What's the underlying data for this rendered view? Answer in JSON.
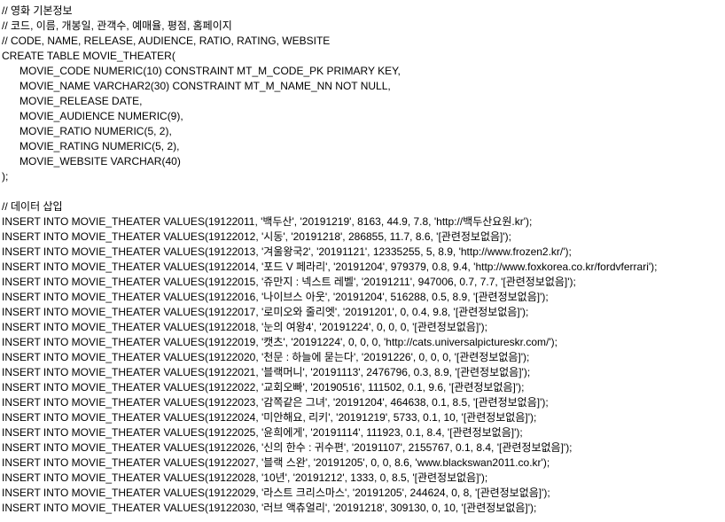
{
  "editor": {
    "comments": [
      "// 영화 기본정보",
      "// 코드, 이름, 개봉일, 관객수, 예매율, 평점, 홈페이지",
      "// CODE, NAME, RELEASE, AUDIENCE, RATIO, RATING, WEBSITE"
    ],
    "create_table": {
      "header": "CREATE TABLE MOVIE_THEATER(",
      "columns": [
        "MOVIE_CODE NUMERIC(10) CONSTRAINT MT_M_CODE_PK PRIMARY KEY,",
        "MOVIE_NAME VARCHAR2(30) CONSTRAINT MT_M_NAME_NN NOT NULL,",
        "MOVIE_RELEASE DATE,",
        "MOVIE_AUDIENCE NUMERIC(9),",
        "MOVIE_RATIO NUMERIC(5, 2),",
        "MOVIE_RATING NUMERIC(5, 2),",
        "MOVIE_WEBSITE VARCHAR(40)"
      ],
      "footer": ");"
    },
    "data_comment": "// 데이터 삽입",
    "inserts": [
      "INSERT INTO MOVIE_THEATER VALUES(19122011, '백두산', '20191219', 8163, 44.9, 7.8, 'http://백두산요원.kr');",
      "INSERT INTO MOVIE_THEATER VALUES(19122012, '시동', '20191218', 286855, 11.7, 8.6, '[관련정보없음]');",
      "INSERT INTO MOVIE_THEATER VALUES(19122013, '겨울왕국2', '20191121', 12335255, 5, 8.9, 'http://www.frozen2.kr/');",
      "INSERT INTO MOVIE_THEATER VALUES(19122014, '포드 V 페라리', '20191204', 979379, 0.8, 9.4, 'http://www.foxkorea.co.kr/fordvferrari');",
      "INSERT INTO MOVIE_THEATER VALUES(19122015, '쥬만지 : 넥스트 레벨', '20191211', 947006, 0.7, 7.7, '[관련정보없음]');",
      "INSERT INTO MOVIE_THEATER VALUES(19122016, '나이브스 아웃', '20191204', 516288, 0.5, 8.9, '[관련정보없음]');",
      "INSERT INTO MOVIE_THEATER VALUES(19122017, '로미오와 줄리엣', '20191201', 0, 0.4, 9.8, '[관련정보없음]');",
      "INSERT INTO MOVIE_THEATER VALUES(19122018, '눈의 여왕4', '20191224', 0, 0, 0, '[관련정보없음]');",
      "INSERT INTO MOVIE_THEATER VALUES(19122019, '캣츠', '20191224', 0, 0, 0, 'http://cats.universalpictureskr.com/');",
      "INSERT INTO MOVIE_THEATER VALUES(19122020, '천문 : 하늘에 묻는다', '20191226', 0, 0, 0, '[관련정보없음]');",
      "INSERT INTO MOVIE_THEATER VALUES(19122021, '블랙머니', '20191113', 2476796, 0.3, 8.9, '[관련정보없음]');",
      "INSERT INTO MOVIE_THEATER VALUES(19122022, '교회오빠', '20190516', 111502, 0.1, 9.6, '[관련정보없음]');",
      "INSERT INTO MOVIE_THEATER VALUES(19122023, '감쪽같은 그녀', '20191204', 464638, 0.1, 8.5, '[관련정보없음]');",
      "INSERT INTO MOVIE_THEATER VALUES(19122024, '미안해요, 리키', '20191219', 5733, 0.1, 10, '[관련정보없음]');",
      "INSERT INTO MOVIE_THEATER VALUES(19122025, '윤희에게', '20191114', 111923, 0.1, 8.4, '[관련정보없음]');",
      "INSERT INTO MOVIE_THEATER VALUES(19122026, '신의 한수 : 귀수편', '20191107', 2155767, 0.1, 8.4, '[관련정보없음]');",
      "INSERT INTO MOVIE_THEATER VALUES(19122027, '블랙 스완', '20191205', 0, 0, 8.6, 'www.blackswan2011.co.kr');",
      "INSERT INTO MOVIE_THEATER VALUES(19122028, '10년', '20191212', 1333, 0, 8.5, '[관련정보없음]');",
      "INSERT INTO MOVIE_THEATER VALUES(19122029, '라스트 크리스마스', '20191205', 244624, 0, 8, '[관련정보없음]');",
      "INSERT INTO MOVIE_THEATER VALUES(19122030, '러브 액츄얼리', '20191218', 309130, 0, 10, '[관련정보없음]');"
    ]
  }
}
